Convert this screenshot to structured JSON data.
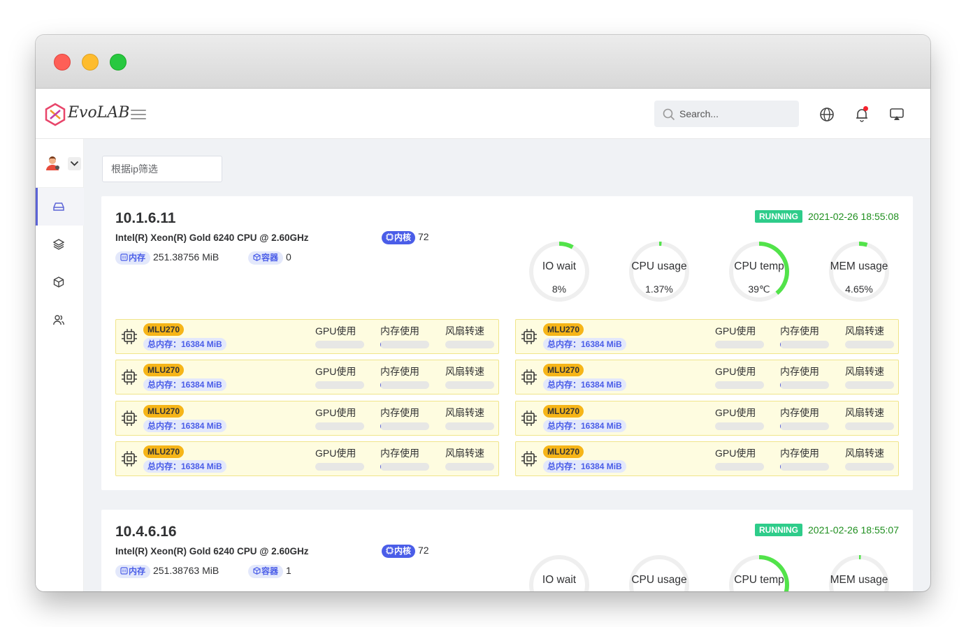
{
  "app": {
    "brand": "EvoLAB",
    "search_placeholder": "Search...",
    "filter_placeholder": "根据ip筛选"
  },
  "sidebar": {
    "items": [
      {
        "name": "dashboard",
        "icon": "hard-drive-icon",
        "active": true
      },
      {
        "name": "layers",
        "icon": "layers-icon",
        "active": false
      },
      {
        "name": "packages",
        "icon": "box-icon",
        "active": false
      },
      {
        "name": "users",
        "icon": "users-icon",
        "active": false
      }
    ]
  },
  "colors": {
    "accent": "#4a5de8",
    "running": "#2ecc8a",
    "gauge": "#52e34a",
    "timestamp": "#1f8f1f",
    "gpu_bg": "#fefce0",
    "gpu_tag": "#f6b518"
  },
  "labels": {
    "cores": "内核",
    "memory": "内存",
    "containers": "容器",
    "gpu_usage": "GPU使用",
    "mem_usage": "内存使用",
    "fan_speed": "风扇转速"
  },
  "servers": [
    {
      "ip": "10.1.6.11",
      "cpu_model": "Intel(R) Xeon(R) Gold 6240 CPU @ 2.60GHz",
      "cores": "72",
      "memory": "251.38756 MiB",
      "containers": "0",
      "status": "RUNNING",
      "timestamp": "2021-02-26 18:55:08",
      "gauges": [
        {
          "label": "IO wait",
          "value": "8%",
          "fraction": 0.08
        },
        {
          "label": "CPU usage",
          "value": "1.37%",
          "fraction": 0.0137
        },
        {
          "label": "CPU temp",
          "value": "39℃",
          "fraction": 0.39
        },
        {
          "label": "MEM usage",
          "value": "4.65%",
          "fraction": 0.0465
        }
      ],
      "gpus": [
        {
          "name": "MLU270",
          "total": "总内存：16384 MiB",
          "gpu": 0,
          "mem": 0.01,
          "fan": 0
        },
        {
          "name": "MLU270",
          "total": "总内存：16384 MiB",
          "gpu": 0,
          "mem": 0.01,
          "fan": 0
        },
        {
          "name": "MLU270",
          "total": "总内存：16384 MiB",
          "gpu": 0,
          "mem": 0.01,
          "fan": 0
        },
        {
          "name": "MLU270",
          "total": "总内存：16384 MiB",
          "gpu": 0,
          "mem": 0.01,
          "fan": 0
        },
        {
          "name": "MLU270",
          "total": "总内存：16384 MiB",
          "gpu": 0,
          "mem": 0.01,
          "fan": 0
        },
        {
          "name": "MLU270",
          "total": "总内存：16384 MiB",
          "gpu": 0,
          "mem": 0.01,
          "fan": 0
        },
        {
          "name": "MLU270",
          "total": "总内存：16384 MiB",
          "gpu": 0,
          "mem": 0.01,
          "fan": 0
        },
        {
          "name": "MLU270",
          "total": "总内存：16384 MiB",
          "gpu": 0,
          "mem": 0.01,
          "fan": 0
        }
      ]
    },
    {
      "ip": "10.4.6.16",
      "cpu_model": "Intel(R) Xeon(R) Gold 6240 CPU @ 2.60GHz",
      "cores": "72",
      "memory": "251.38763 MiB",
      "containers": "1",
      "status": "RUNNING",
      "timestamp": "2021-02-26 18:55:07",
      "gauges": [
        {
          "label": "IO wait",
          "value": "",
          "fraction": 0
        },
        {
          "label": "CPU usage",
          "value": "",
          "fraction": 0
        },
        {
          "label": "CPU temp",
          "value": "",
          "fraction": 0.39
        },
        {
          "label": "MEM usage",
          "value": "",
          "fraction": 0.01
        }
      ],
      "gpus": []
    }
  ]
}
